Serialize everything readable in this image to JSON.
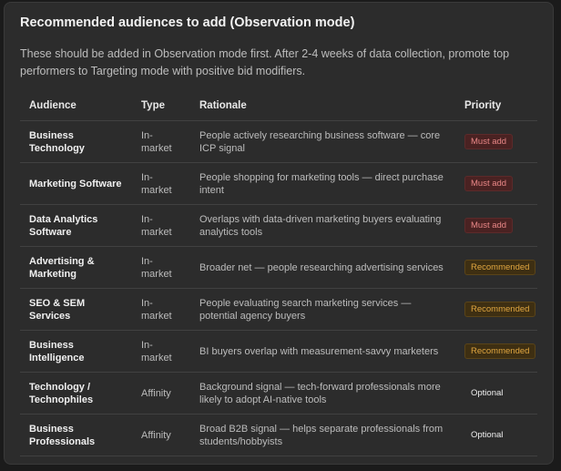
{
  "title": "Recommended audiences to add (Observation mode)",
  "description": "These should be added in Observation mode first. After 2-4 weeks of data collection, promote top performers to Targeting mode with positive bid modifiers.",
  "columns": [
    "Audience",
    "Type",
    "Rationale",
    "Priority"
  ],
  "rows": [
    {
      "audience": "Business Technology",
      "type": "In-market",
      "rationale": "People actively researching business software — core ICP signal",
      "priority": "Must add",
      "level": "must"
    },
    {
      "audience": "Marketing Software",
      "type": "In-market",
      "rationale": "People shopping for marketing tools — direct purchase intent",
      "priority": "Must add",
      "level": "must"
    },
    {
      "audience": "Data Analytics Software",
      "type": "In-market",
      "rationale": "Overlaps with data-driven marketing buyers evaluating analytics tools",
      "priority": "Must add",
      "level": "must"
    },
    {
      "audience": "Advertising & Marketing",
      "type": "In-market",
      "rationale": "Broader net — people researching advertising services",
      "priority": "Recommended",
      "level": "rec"
    },
    {
      "audience": "SEO & SEM Services",
      "type": "In-market",
      "rationale": "People evaluating search marketing services — potential agency buyers",
      "priority": "Recommended",
      "level": "rec"
    },
    {
      "audience": "Business Intelligence",
      "type": "In-market",
      "rationale": "BI buyers overlap with measurement-savvy marketers",
      "priority": "Recommended",
      "level": "rec"
    },
    {
      "audience": "Technology / Technophiles",
      "type": "Affinity",
      "rationale": "Background signal — tech-forward professionals more likely to adopt AI-native tools",
      "priority": "Optional",
      "level": "opt"
    },
    {
      "audience": "Business Professionals",
      "type": "Affinity",
      "rationale": "Broad B2B signal — helps separate professionals from students/hobbyists",
      "priority": "Optional",
      "level": "opt"
    }
  ]
}
